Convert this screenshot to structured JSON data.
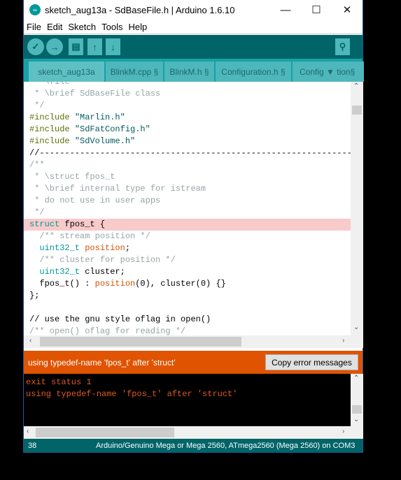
{
  "window": {
    "title": "sketch_aug13a - SdBaseFile.h | Arduino 1.6.10",
    "minimize": "—",
    "maximize": "☐",
    "close": "✕"
  },
  "menu": [
    "File",
    "Edit",
    "Sketch",
    "Tools",
    "Help"
  ],
  "toolbar": {
    "verify": "✓",
    "upload": "→",
    "new": "▤",
    "open": "↑",
    "save": "↓",
    "serial_monitor": "⚲"
  },
  "tabs": [
    "sketch_aug13a",
    "BlinkM.cpp §",
    "BlinkM.h §",
    "Configuration.h §",
    "Config ▼ tion§"
  ],
  "code": [
    [
      [
        "cm",
        " * \\file"
      ]
    ],
    [
      [
        "cm",
        " * \\brief SdBaseFile class"
      ]
    ],
    [
      [
        "cm",
        " */"
      ]
    ],
    [
      [
        "pp",
        "#include "
      ],
      [
        "st",
        "\"Marlin.h\""
      ]
    ],
    [
      [
        "pp",
        "#include "
      ],
      [
        "st",
        "\"SdFatConfig.h\""
      ]
    ],
    [
      [
        "pp",
        "#include "
      ],
      [
        "st",
        "\"SdVolume.h\""
      ]
    ],
    [
      [
        "",
        "//------------------------------------------------------------------"
      ]
    ],
    [
      [
        "cm",
        "/**"
      ]
    ],
    [
      [
        "cm",
        " * \\struct fpos_t"
      ]
    ],
    [
      [
        "cm",
        " * \\brief internal type for istream"
      ]
    ],
    [
      [
        "cm",
        " * do not use in user apps"
      ]
    ],
    [
      [
        "cm",
        " */"
      ]
    ],
    [
      [
        "kw",
        "struct"
      ],
      [
        "",
        " fpos_t {"
      ]
    ],
    [
      [
        "cm",
        "  /** stream position */"
      ]
    ],
    [
      [
        "kw",
        "  uint32_t"
      ],
      [
        "",
        " "
      ],
      [
        "fn",
        "position"
      ],
      [
        "",
        ";"
      ]
    ],
    [
      [
        "cm",
        "  /** cluster for position */"
      ]
    ],
    [
      [
        "kw",
        "  uint32_t"
      ],
      [
        "",
        " cluster;"
      ]
    ],
    [
      [
        "",
        "  fpos_t() : "
      ],
      [
        "fn",
        "position"
      ],
      [
        "",
        "(0), cluster(0) {}"
      ]
    ],
    [
      [
        "",
        "};"
      ]
    ],
    [
      [
        "",
        ""
      ]
    ],
    [
      [
        "",
        "// use the gnu style oflag in open()"
      ]
    ],
    [
      [
        "cm",
        "/** open() oflag for reading */"
      ]
    ]
  ],
  "highlight_line": 12,
  "error": {
    "message": "using typedef-name 'fpos_t' after 'struct'",
    "copy_button": "Copy error messages"
  },
  "console": [
    "exit status 1",
    "using typedef-name 'fpos_t' after 'struct'"
  ],
  "status": {
    "line": "38",
    "board": "Arduino/Genuino Mega or Mega 2560, ATmega2560 (Mega 2560) on COM3"
  },
  "colors": {
    "teal_dark": "#006468",
    "teal": "#17a1a5",
    "tab": "#4db7bb",
    "error": "#e05300",
    "highlight": "#f8caca"
  }
}
